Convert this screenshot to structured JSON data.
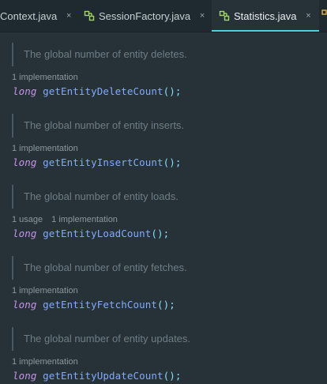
{
  "tabs": [
    {
      "label": "Context.java",
      "active": false,
      "icon": null
    },
    {
      "label": "SessionFactory.java",
      "active": false,
      "icon": "interface-icon"
    },
    {
      "label": "Statistics.java",
      "active": true,
      "icon": "interface-icon"
    }
  ],
  "tab_close_glyph": "×",
  "methods": [
    {
      "doc": "The global number of entity deletes.",
      "usages": "",
      "implementations": "1 implementation",
      "return_type": "long",
      "name": "getEntityDeleteCount",
      "parens": "();"
    },
    {
      "doc": "The global number of entity inserts.",
      "usages": "",
      "implementations": "1 implementation",
      "return_type": "long",
      "name": "getEntityInsertCount",
      "parens": "();"
    },
    {
      "doc": "The global number of entity loads.",
      "usages": "1 usage",
      "implementations": "1 implementation",
      "return_type": "long",
      "name": "getEntityLoadCount",
      "parens": "();"
    },
    {
      "doc": "The global number of entity fetches.",
      "usages": "",
      "implementations": "1 implementation",
      "return_type": "long",
      "name": "getEntityFetchCount",
      "parens": "();"
    },
    {
      "doc": "The global number of entity updates.",
      "usages": "",
      "implementations": "1 implementation",
      "return_type": "long",
      "name": "getEntityUpdateCount",
      "parens": "();"
    }
  ],
  "colors": {
    "background": "#263238",
    "tabbar": "#1f2a30",
    "active_tab_underline": "#4dd0e1",
    "keyword": "#c792ea",
    "method_name": "#82aaff",
    "punctuation": "#89ddff",
    "doc_text": "#6f7e85",
    "inlay_hint": "#8a989e",
    "interface_icon": "#a5d66a"
  }
}
